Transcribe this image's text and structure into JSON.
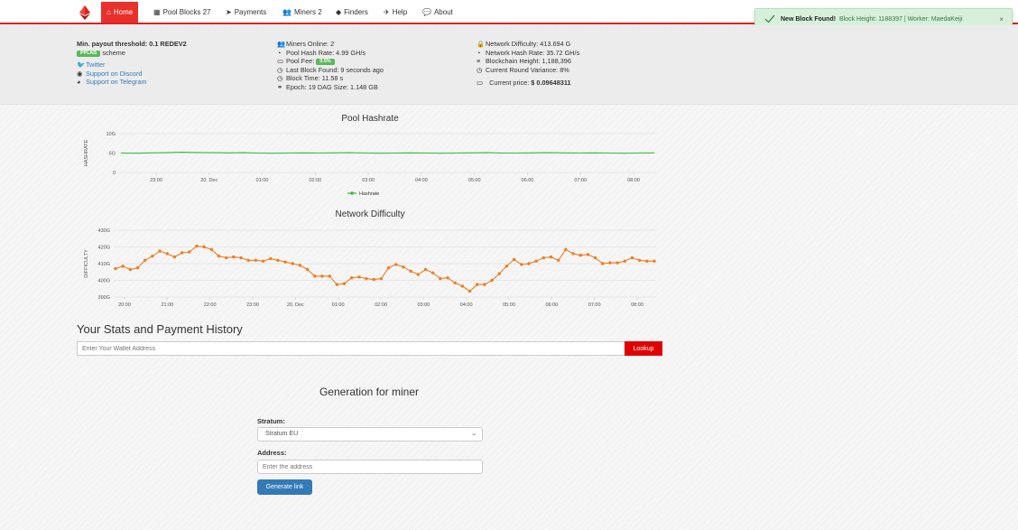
{
  "nav": {
    "items": [
      {
        "label": "Home",
        "icon": "home-icon",
        "glyph": "⌂"
      },
      {
        "label": "Pool Blocks 27",
        "icon": "cubes-icon",
        "glyph": "▦"
      },
      {
        "label": "Payments",
        "icon": "paper-plane-icon",
        "glyph": "➤"
      },
      {
        "label": "Miners 2",
        "icon": "users-icon",
        "glyph": "👥"
      },
      {
        "label": "Finders",
        "icon": "diamond-icon",
        "glyph": "◆"
      },
      {
        "label": "Help",
        "icon": "send-icon",
        "glyph": "✈"
      },
      {
        "label": "About",
        "icon": "comments-icon",
        "glyph": "💬"
      }
    ]
  },
  "toast": {
    "title": "New Block Found!",
    "text": "Block Height: 1188397 | Worker: MaedaKeiji",
    "close": "×"
  },
  "stats": {
    "payout": "Min. payout threshold: 0.1 REDEV2",
    "scheme_badge": "PPLNS",
    "scheme": "scheme",
    "twitter": "Twitter",
    "discord": "Support on Discord",
    "telegram": "Support on Telegram",
    "miners_online": "Miners Online: 2",
    "pool_hash": "Pool Hash Rate: 4.99 GH/s",
    "pool_fee_label": "Pool Fee:",
    "pool_fee_badge": "0.5%",
    "last_block": "Last Block Found: 9 seconds ago",
    "block_time": "Block Time: 11.58 s",
    "epoch": "Epoch: 19 DAG Size: 1.148 GB",
    "net_diff": "Network Difficulty: 413.694 G",
    "net_hash": "Network Hash Rate: 35.72 GH/s",
    "chain_height": "Blockchain Height: 1,188,396",
    "round_var": "Current Round Variance: 8%",
    "price_label": "Current price:",
    "price_value": "$ 0.09648311"
  },
  "colors": {
    "accent": "#e8302c",
    "hashrate": "#2fbe3a",
    "difficulty": "#f07e1e",
    "primary": "#337ab7"
  },
  "chart_data": [
    {
      "type": "line",
      "title": "Pool Hashrate",
      "ylabel": "HASHRATE",
      "yticks": [
        "10G",
        "5G",
        "0"
      ],
      "ylim": [
        0,
        10
      ],
      "xticks": [
        "23:00",
        "20. Dec",
        "01:00",
        "02:00",
        "03:00",
        "04:00",
        "05:00",
        "06:00",
        "07:00",
        "08:00"
      ],
      "legend": "Hashrate",
      "series": [
        {
          "name": "Hashrate",
          "values": [
            5.0,
            4.95,
            5.05,
            5.1,
            5.2,
            5.15,
            5.1,
            5.05,
            5.1,
            5.0,
            4.95,
            5.0,
            5.05,
            5.0,
            5.05,
            5.1,
            5.0,
            4.95,
            5.0,
            5.05,
            5.0,
            4.95,
            5.0,
            5.05,
            5.1,
            5.0,
            5.0,
            5.05,
            5.1,
            5.05,
            5.0,
            5.05,
            5.0,
            4.95,
            5.0,
            5.05
          ]
        }
      ]
    },
    {
      "type": "line",
      "title": "Network Difficulty",
      "ylabel": "DIFFICULTY",
      "yticks": [
        "430G",
        "420G",
        "410G",
        "400G",
        "390G"
      ],
      "ylim": [
        390,
        430
      ],
      "xticks": [
        "20:00",
        "21:00",
        "22:00",
        "23:00",
        "20. Dec",
        "01:00",
        "02:00",
        "03:00",
        "04:00",
        "05:00",
        "06:00",
        "07:00",
        "08:00"
      ],
      "series": [
        {
          "name": "Difficulty",
          "values": [
            407,
            408.5,
            406.5,
            407.5,
            412,
            414.5,
            417.5,
            416,
            414,
            416.5,
            417,
            420.5,
            420,
            418.5,
            414.5,
            413.5,
            414,
            413.5,
            412,
            412,
            411.5,
            413,
            412,
            411,
            410,
            409,
            406.5,
            402.5,
            402.5,
            402.5,
            397.5,
            398,
            401.5,
            402,
            401,
            400.5,
            401,
            407.5,
            409.5,
            408,
            405.5,
            403.5,
            406.5,
            404.5,
            401,
            401.5,
            398.5,
            396.5,
            393.5,
            397.5,
            397.5,
            400,
            404,
            408.5,
            412.5,
            409.5,
            410,
            411.5,
            413.5,
            414,
            412,
            418.5,
            416,
            415,
            415.5,
            413.5,
            410,
            410.5,
            410.5,
            411.5,
            413.5,
            412,
            411.5,
            411.5
          ]
        }
      ]
    }
  ],
  "stats_section": {
    "title": "Your Stats and Payment History",
    "wallet_placeholder": "Enter Your Wallet Address",
    "lookup": "Lookup"
  },
  "generator": {
    "title": "Generation for miner",
    "stratum_label": "Stratum:",
    "stratum_value": "Stratum EU",
    "address_label": "Address:",
    "address_placeholder": "Enter the address",
    "button": "Generate link"
  }
}
